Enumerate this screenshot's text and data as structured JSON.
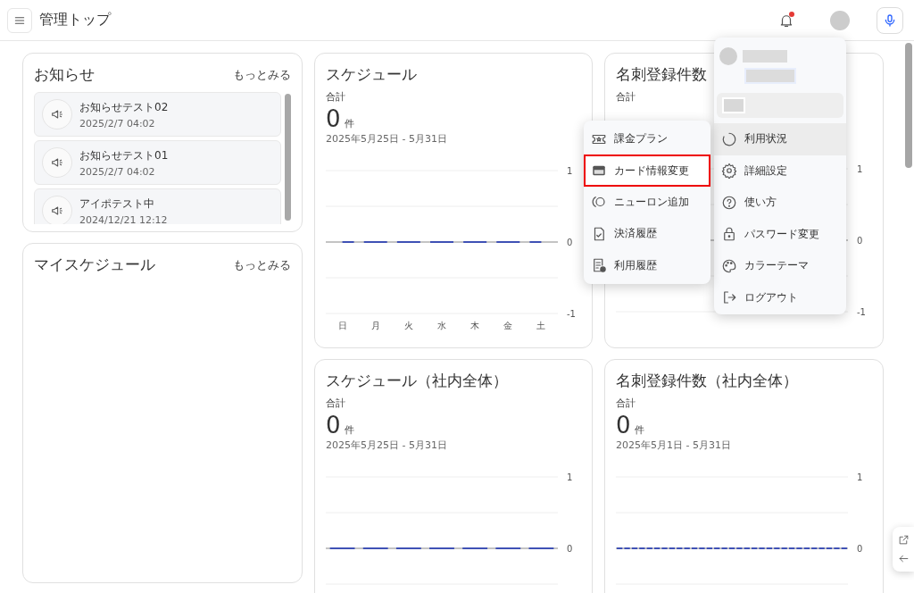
{
  "header": {
    "title": "管理トップ",
    "has_unread": true
  },
  "notices": {
    "title": "お知らせ",
    "more": "もっとみる",
    "items": [
      {
        "title": "お知らせテスト02",
        "date": "2025/2/7 04:02"
      },
      {
        "title": "お知らせテスト01",
        "date": "2025/2/7 04:02"
      },
      {
        "title": "アイポテスト中",
        "date": "2024/12/21 12:12"
      }
    ]
  },
  "my_schedule": {
    "title": "マイスケジュール",
    "more": "もっとみる"
  },
  "stat_cards": [
    {
      "title": "スケジュール",
      "total_label": "合計",
      "total": "0",
      "unit": "件",
      "range": "2025年5月25日 - 5月31日",
      "chart_data": {
        "type": "line",
        "categories": [
          "日",
          "月",
          "火",
          "水",
          "木",
          "金",
          "土"
        ],
        "ylim": [
          -1,
          1
        ],
        "yticks": [
          -1,
          0,
          1
        ],
        "ref_lines": [
          {
            "axis": "y",
            "value": 0.5
          },
          {
            "axis": "y",
            "value": -0.5
          }
        ],
        "series": [
          {
            "color": "#3f51b5",
            "line_style": "dashed",
            "values": [
              0,
              0,
              0,
              0,
              0,
              0,
              0
            ]
          }
        ]
      }
    },
    {
      "title": "名刺登録件数",
      "total_label": "合計",
      "axis_labels": [
        "1",
        "0",
        "-1"
      ]
    },
    {
      "title": "スケジュール（社内全体）",
      "total_label": "合計",
      "total": "0",
      "unit": "件",
      "range": "2025年5月25日 - 5月31日",
      "axis_labels": [
        "1",
        "0"
      ]
    },
    {
      "title": "名刺登録件数（社内全体）",
      "total_label": "合計",
      "total": "0",
      "unit": "件",
      "range": "2025年5月1日 - 5月31日",
      "axis_labels": [
        "1",
        "0"
      ]
    }
  ],
  "account_menu": {
    "items": [
      {
        "label": "利用状況",
        "selected": true
      },
      {
        "label": "詳細設定",
        "selected": false
      },
      {
        "label": "使い方",
        "selected": false
      },
      {
        "label": "パスワード変更",
        "selected": false
      },
      {
        "label": "カラーテーマ",
        "selected": false
      },
      {
        "label": "ログアウト",
        "selected": false
      }
    ]
  },
  "usage_submenu": {
    "items": [
      {
        "label": "課金プラン",
        "highlighted": false
      },
      {
        "label": "カード情報変更",
        "highlighted": true
      },
      {
        "label": "ニューロン追加",
        "highlighted": false
      },
      {
        "label": "決済履歴",
        "highlighted": false
      },
      {
        "label": "利用履歴",
        "highlighted": false
      }
    ]
  }
}
